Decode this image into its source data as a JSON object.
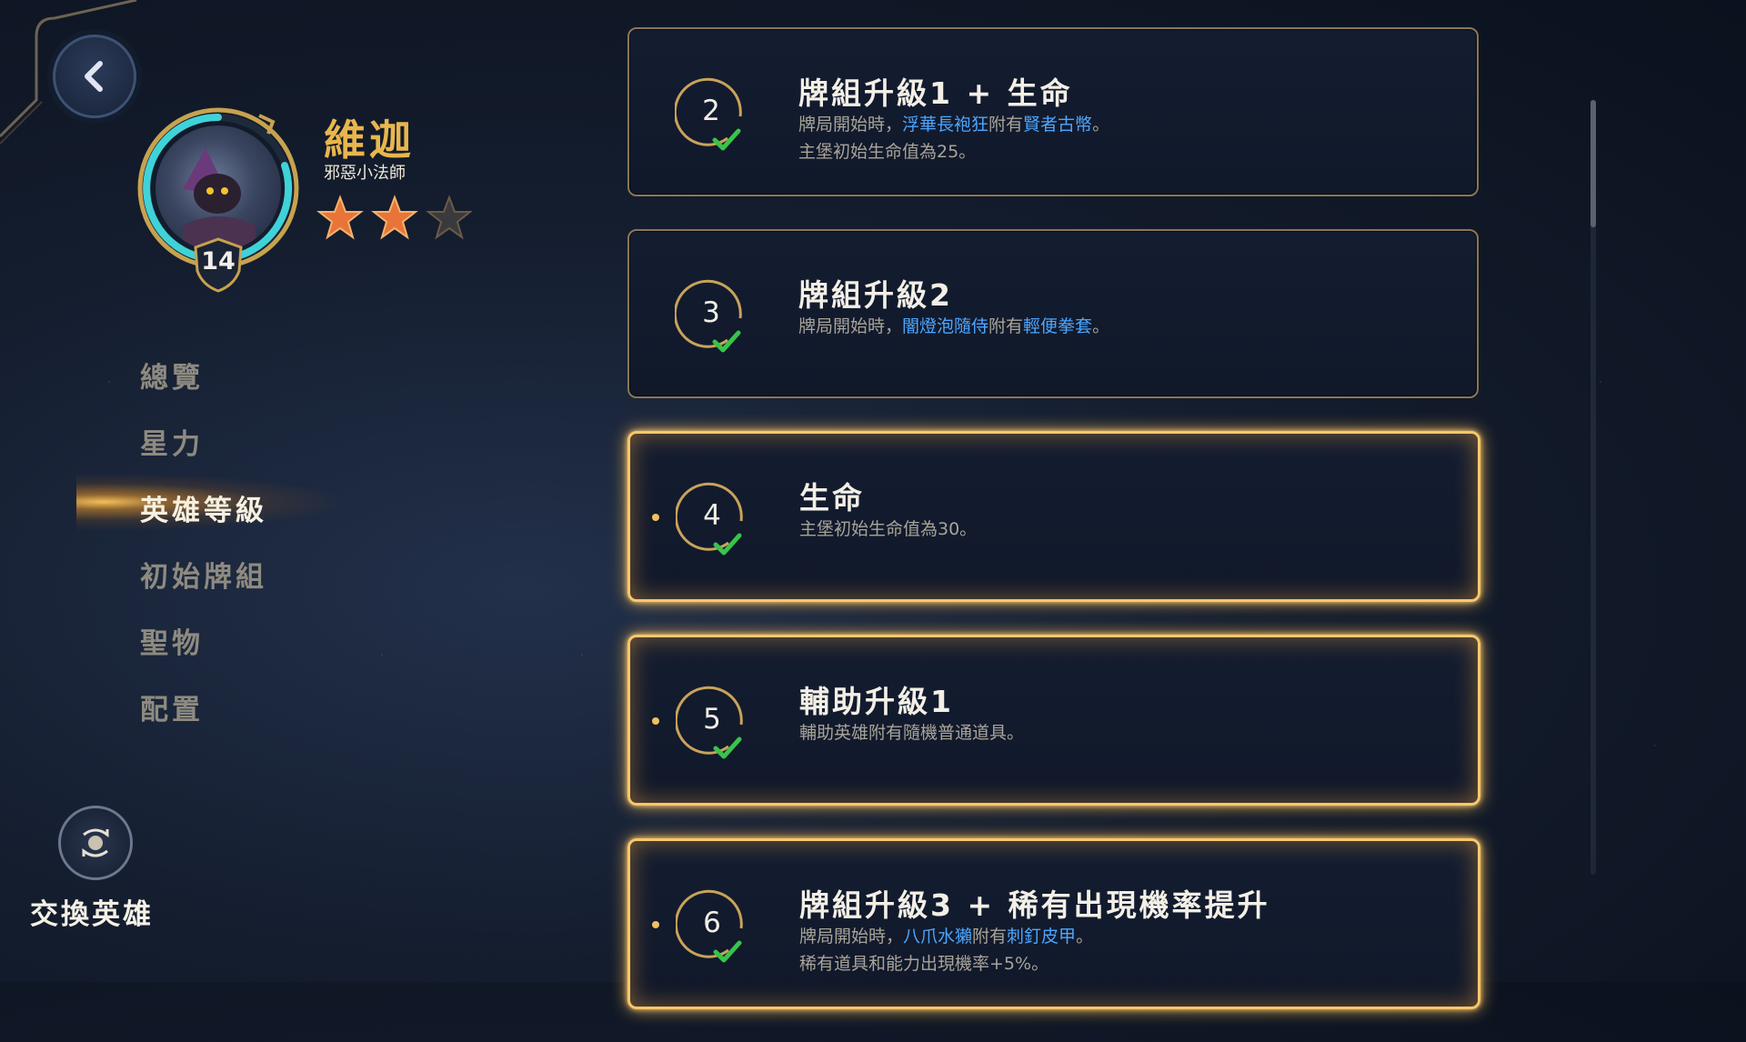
{
  "hero": {
    "name": "維迦",
    "title": "邪惡小法師",
    "level": "14",
    "stars_filled": 2,
    "stars_total": 3
  },
  "nav": {
    "items": [
      "總覽",
      "星力",
      "英雄等級",
      "初始牌組",
      "聖物",
      "配置"
    ],
    "active": "英雄等級"
  },
  "swap": {
    "label": "交換英雄"
  },
  "cards": [
    {
      "level": "2",
      "title": "牌組升級1 + 生命",
      "highlight": false,
      "lines": [
        [
          {
            "t": "牌局開始時，",
            "hl": false
          },
          {
            "t": "浮華長袍狂",
            "hl": true
          },
          {
            "t": "附有",
            "hl": false
          },
          {
            "t": "賢者古幣",
            "hl": true
          },
          {
            "t": "。",
            "hl": false
          }
        ],
        [
          {
            "t": "主堡初始生命值為25。",
            "hl": false
          }
        ]
      ]
    },
    {
      "level": "3",
      "title": "牌組升級2",
      "highlight": false,
      "lines": [
        [
          {
            "t": "牌局開始時，",
            "hl": false
          },
          {
            "t": "闇燈泡隨侍",
            "hl": true
          },
          {
            "t": "附有",
            "hl": false
          },
          {
            "t": "輕便拳套",
            "hl": true
          },
          {
            "t": "。",
            "hl": false
          }
        ]
      ]
    },
    {
      "level": "4",
      "title": "生命",
      "highlight": true,
      "lines": [
        [
          {
            "t": "主堡初始生命值為30。",
            "hl": false
          }
        ]
      ]
    },
    {
      "level": "5",
      "title": "輔助升級1",
      "highlight": true,
      "lines": [
        [
          {
            "t": "輔助英雄附有隨機普通道具。",
            "hl": false
          }
        ]
      ]
    },
    {
      "level": "6",
      "title": "牌組升級3 + 稀有出現機率提升",
      "highlight": true,
      "lines": [
        [
          {
            "t": "牌局開始時，",
            "hl": false
          },
          {
            "t": "八爪水獺",
            "hl": true
          },
          {
            "t": "附有",
            "hl": false
          },
          {
            "t": "刺釘皮甲",
            "hl": true
          },
          {
            "t": "。",
            "hl": false
          }
        ],
        [
          {
            "t": "稀有道具和能力出現機率+5%。",
            "hl": false
          }
        ]
      ]
    }
  ],
  "colors": {
    "gold": "#e8b64d",
    "highlight_text": "#4da6ff",
    "check": "#38c44a",
    "glow": "#f8c86a"
  },
  "icons": {
    "back": "chevron-left-icon",
    "star": "star-icon",
    "check": "check-icon",
    "swap": "swap-hero-icon"
  }
}
